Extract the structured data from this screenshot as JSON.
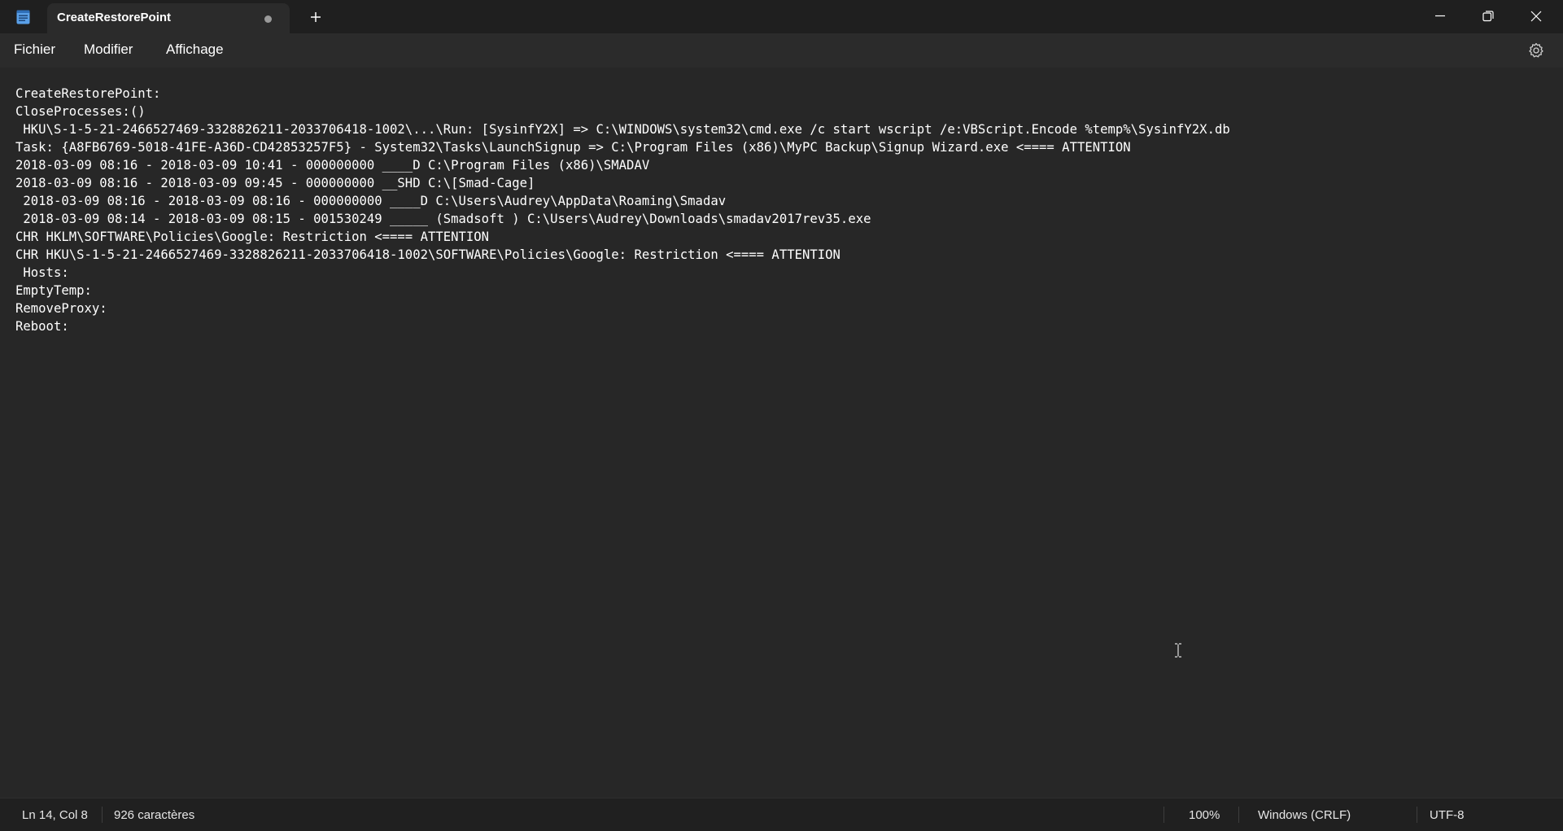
{
  "window": {
    "tab_title": "CreateRestorePoint",
    "new_tab_symbol": "+"
  },
  "menu": {
    "items": [
      "Fichier",
      "Modifier",
      "Affichage"
    ]
  },
  "editor": {
    "lines": [
      "CreateRestorePoint:",
      "CloseProcesses:()",
      " HKU\\S-1-5-21-2466527469-3328826211-2033706418-1002\\...\\Run: [SysinfY2X] => C:\\WINDOWS\\system32\\cmd.exe /c start wscript /e:VBScript.Encode %temp%\\SysinfY2X.db",
      "Task: {A8FB6769-5018-41FE-A36D-CD42853257F5} - System32\\Tasks\\LaunchSignup => C:\\Program Files (x86)\\MyPC Backup\\Signup Wizard.exe <==== ATTENTION",
      "2018-03-09 08:16 - 2018-03-09 10:41 - 000000000 ____D C:\\Program Files (x86)\\SMADAV",
      "2018-03-09 08:16 - 2018-03-09 09:45 - 000000000 __SHD C:\\[Smad-Cage]",
      " 2018-03-09 08:16 - 2018-03-09 08:16 - 000000000 ____D C:\\Users\\Audrey\\AppData\\Roaming\\Smadav",
      " 2018-03-09 08:14 - 2018-03-09 08:15 - 001530249 _____ (Smadsoft ) C:\\Users\\Audrey\\Downloads\\smadav2017rev35.exe",
      "CHR HKLM\\SOFTWARE\\Policies\\Google: Restriction <==== ATTENTION",
      "CHR HKU\\S-1-5-21-2466527469-3328826211-2033706418-1002\\SOFTWARE\\Policies\\Google: Restriction <==== ATTENTION",
      " Hosts:",
      "EmptyTemp:",
      "RemoveProxy:",
      "Reboot:"
    ]
  },
  "status": {
    "position": "Ln 14, Col 8",
    "char_count": "926 caractères",
    "zoom": "100%",
    "line_ending": "Windows (CRLF)",
    "encoding": "UTF-8"
  },
  "icons": {
    "app": "notepad-icon",
    "unsaved": "unsaved-dot-icon",
    "settings": "gear-icon",
    "minimize": "minimize-icon",
    "restore": "restore-icon",
    "close": "close-icon",
    "cursor": "text-cursor-icon"
  }
}
